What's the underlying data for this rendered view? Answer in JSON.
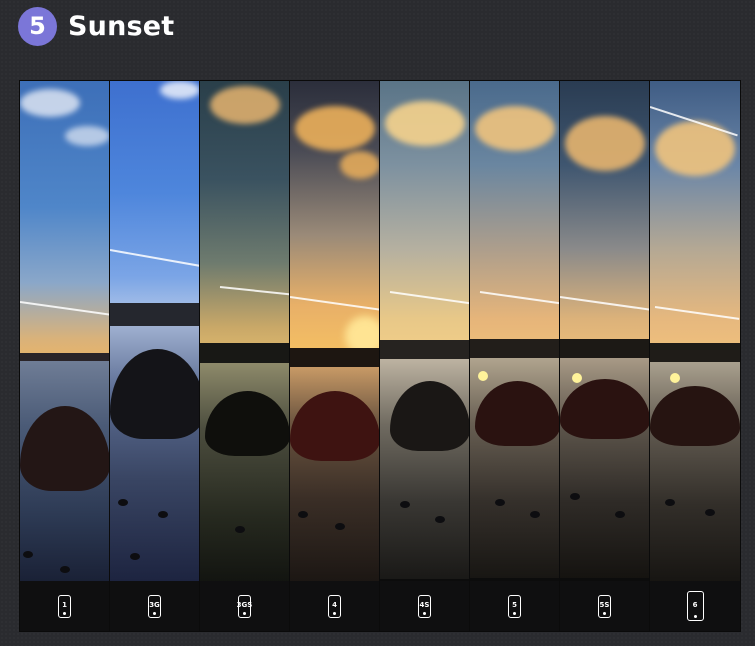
{
  "section": {
    "number": "5",
    "title": "Sunset"
  },
  "panels": [
    {
      "model": "1"
    },
    {
      "model": "3G"
    },
    {
      "model": "3GS"
    },
    {
      "model": "4"
    },
    {
      "model": "4S"
    },
    {
      "model": "5"
    },
    {
      "model": "5S"
    },
    {
      "model": "6"
    }
  ],
  "colors": {
    "badge": "#7b76d8",
    "background": "#2a2b2f"
  },
  "icons": {
    "phone": "phone-icon"
  }
}
